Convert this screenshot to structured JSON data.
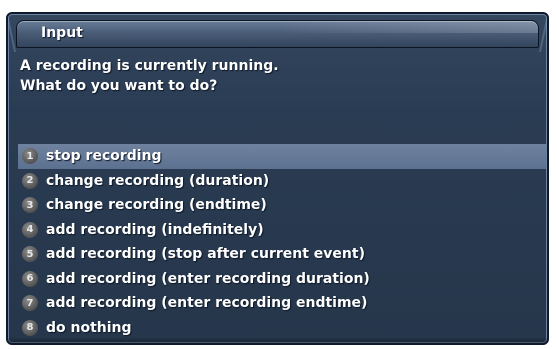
{
  "dialog": {
    "title": "Input",
    "message_lines": [
      "A recording is currently running.",
      "What do you want to do?"
    ],
    "selected_index": 0,
    "choices": [
      {
        "number": "1",
        "label": "stop recording"
      },
      {
        "number": "2",
        "label": "change recording (duration)"
      },
      {
        "number": "3",
        "label": "change recording (endtime)"
      },
      {
        "number": "4",
        "label": "add recording (indefinitely)"
      },
      {
        "number": "5",
        "label": "add recording (stop after current event)"
      },
      {
        "number": "6",
        "label": "add recording (enter recording duration)"
      },
      {
        "number": "7",
        "label": "add recording (enter recording endtime)"
      },
      {
        "number": "8",
        "label": "do nothing"
      }
    ]
  },
  "colors": {
    "background": "#2a3c53",
    "selection": "#6f83a0",
    "text": "#ffffff",
    "number_badge": "#5a5a5a"
  }
}
